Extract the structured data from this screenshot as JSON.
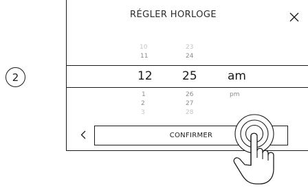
{
  "step": {
    "number": "2"
  },
  "dialog": {
    "title": "RÉGLER HORLOGE",
    "confirm_label": "CONFIRMER"
  },
  "picker": {
    "hours": {
      "above": [
        "10",
        "11"
      ],
      "selected": "12",
      "below": [
        "1",
        "2",
        "3"
      ]
    },
    "minutes": {
      "above": [
        "23",
        "24"
      ],
      "selected": "25",
      "below": [
        "26",
        "27",
        "28"
      ]
    },
    "period": {
      "above": [],
      "selected": "am",
      "below": [
        "pm"
      ]
    }
  },
  "icons": {
    "close": "close-icon",
    "back": "chevron-left-icon",
    "touch": "tap-hand-icon"
  },
  "colors": {
    "line": "#1a1a1a",
    "faint": "#c4c4c4",
    "mid": "#8a8a8a"
  }
}
